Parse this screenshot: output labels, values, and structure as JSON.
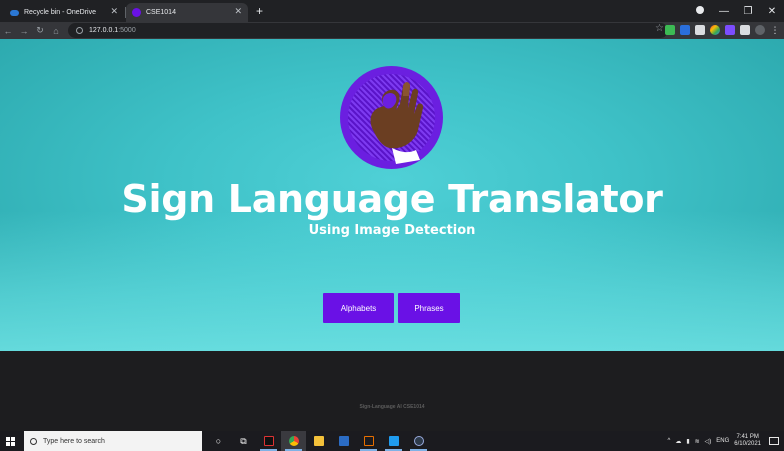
{
  "browser": {
    "tabs": [
      {
        "title": "Recycle bin - OneDrive",
        "active": false
      },
      {
        "title": "CSE1014",
        "active": true
      }
    ],
    "new_tab": "+",
    "address": {
      "host": "127.0.0.1",
      "port": ":5000"
    },
    "window_controls": [
      "—",
      "❐",
      "✕"
    ]
  },
  "page": {
    "title": "Sign Language Translator",
    "subtitle": "Using Image Detection",
    "buttons": {
      "alphabets": "Alphabets",
      "phrases": "Phrases"
    },
    "footer": "Sign-Language AI CSE1014",
    "colors": {
      "accent": "#6a11e6",
      "background": "#3fc2c8",
      "footer": "#1d1d1f"
    }
  },
  "taskbar": {
    "search_placeholder": "Type here to search",
    "language": "ENG",
    "time": "7:41 PM",
    "date": "6/10/2021"
  }
}
